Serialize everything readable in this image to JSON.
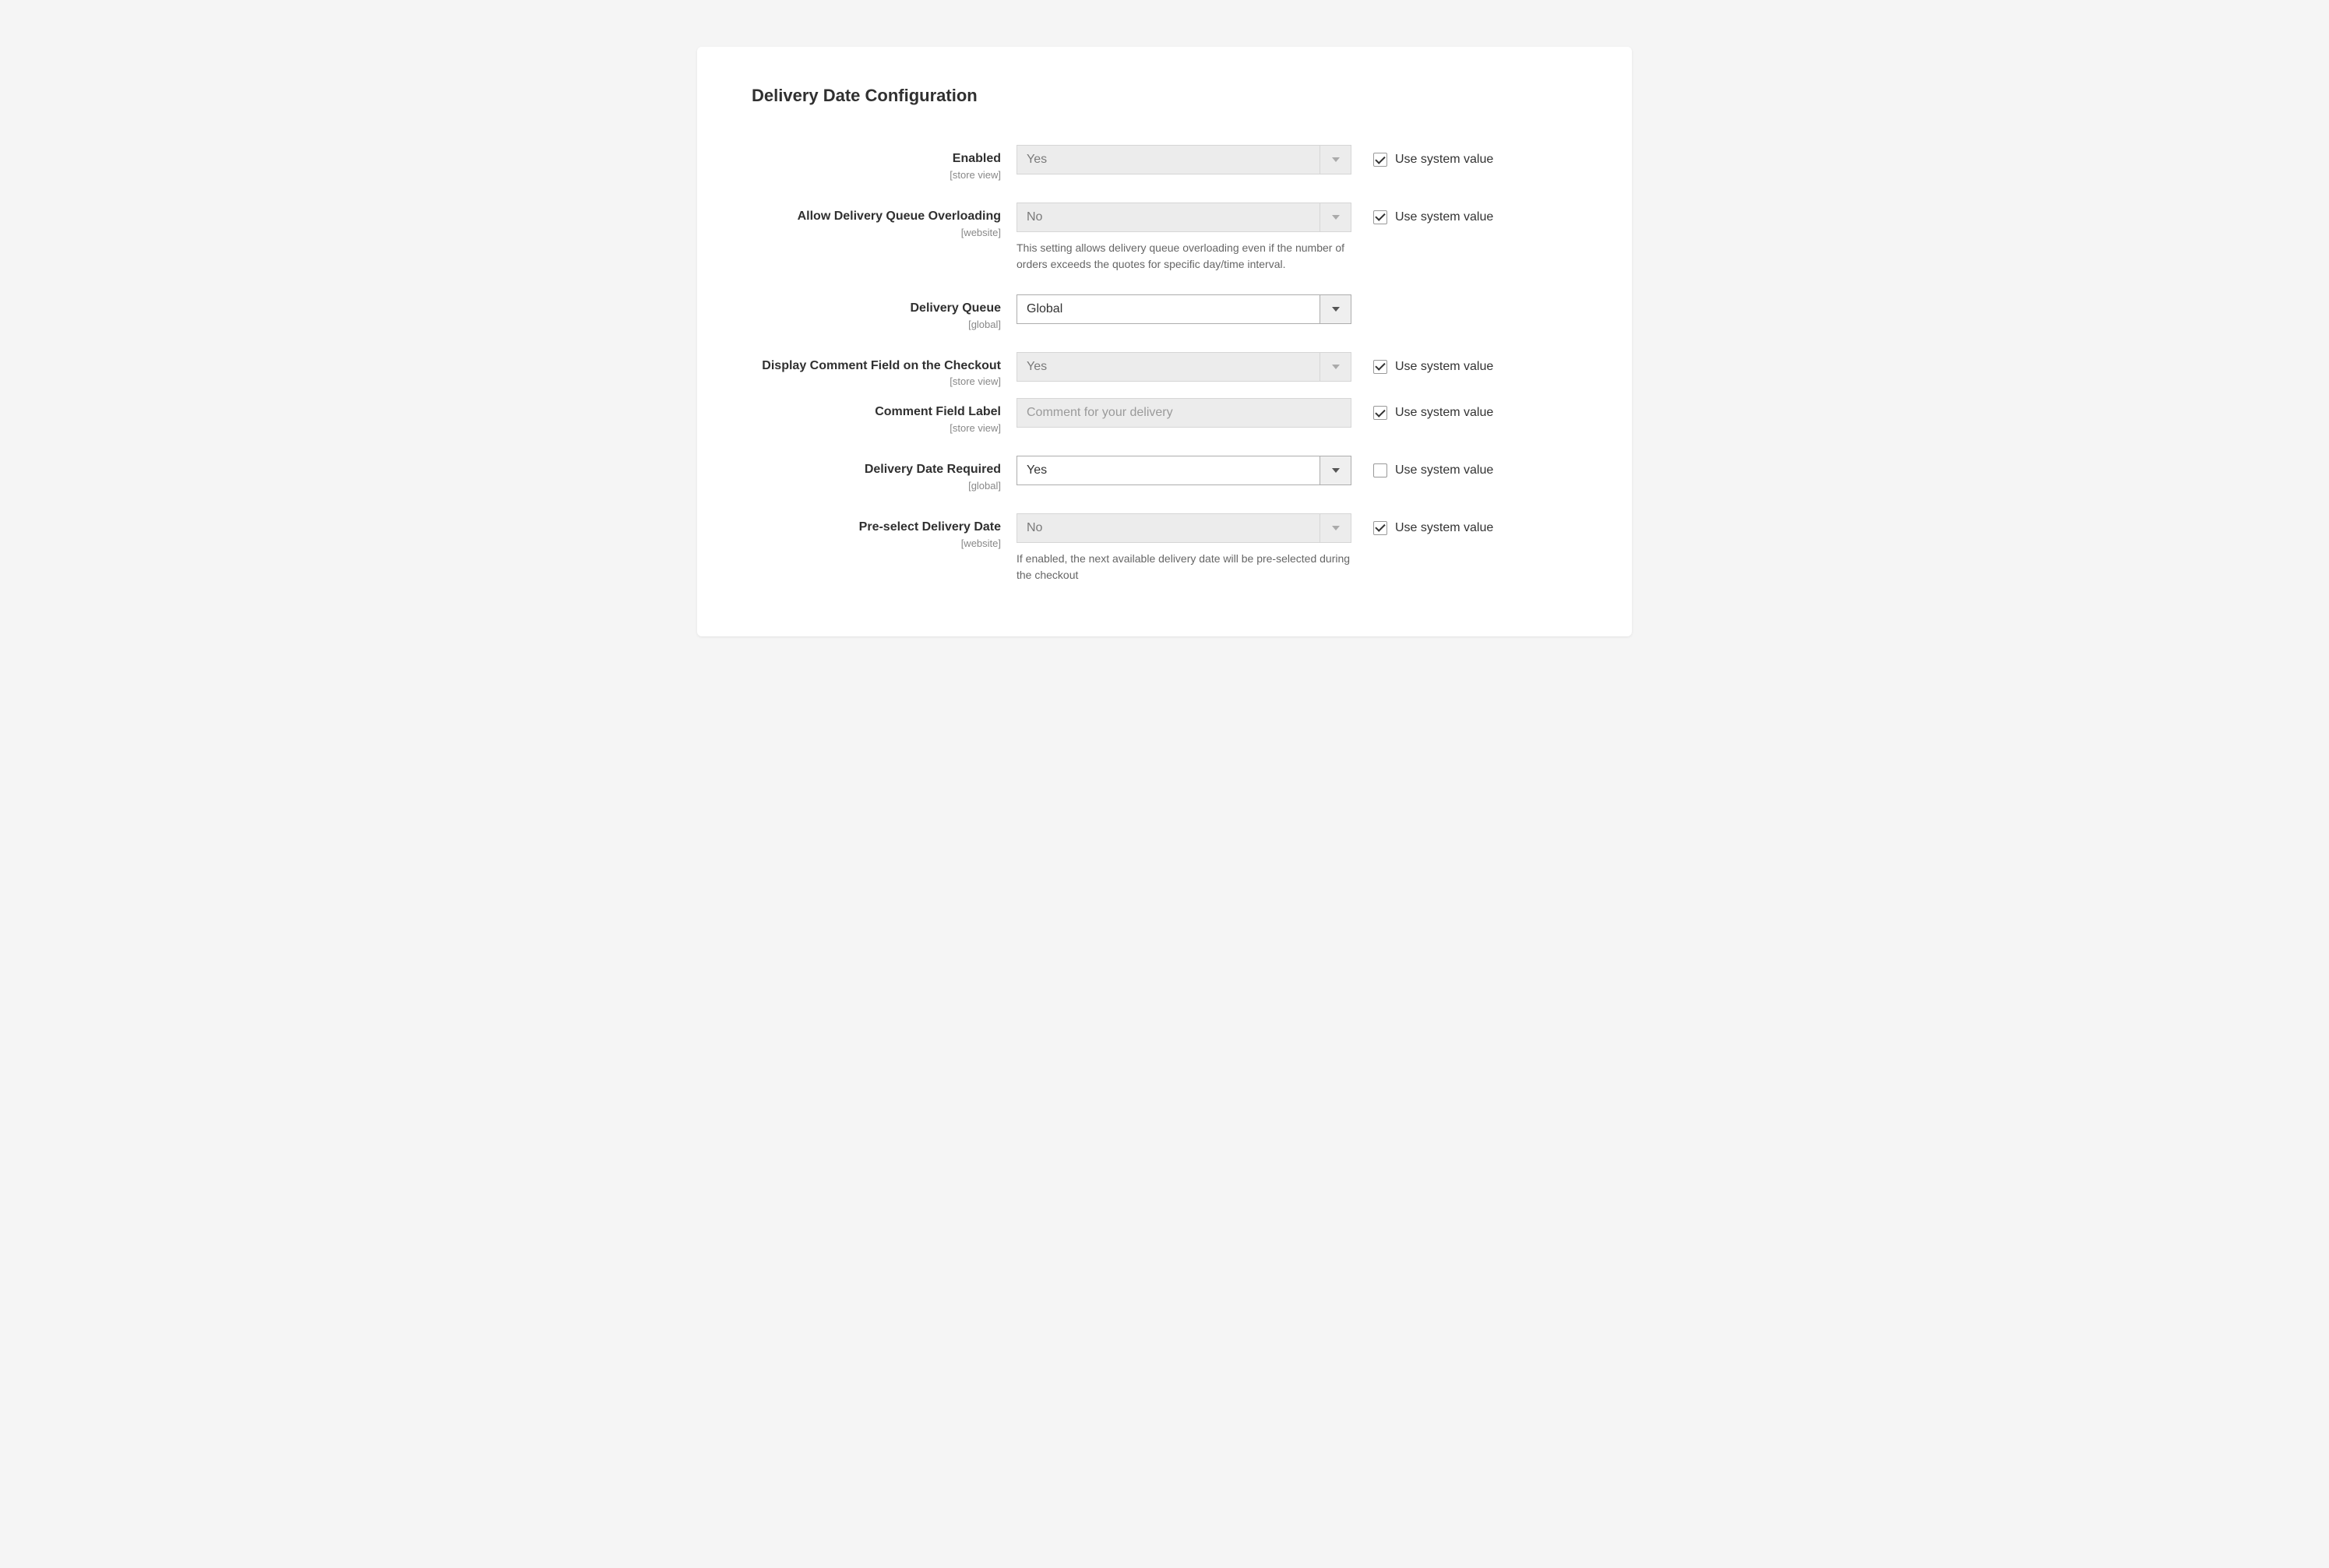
{
  "section_title": "Delivery Date Configuration",
  "use_system_value_label": "Use system value",
  "fields": {
    "enabled": {
      "label": "Enabled",
      "scope": "[store view]",
      "value": "Yes",
      "disabled": true,
      "use_system": true
    },
    "overloading": {
      "label": "Allow Delivery Queue Overloading",
      "scope": "[website]",
      "value": "No",
      "disabled": true,
      "use_system": true,
      "help": "This setting allows delivery queue overloading even if the number of orders exceeds the quotes for specific day/time interval."
    },
    "queue": {
      "label": "Delivery Queue",
      "scope": "[global]",
      "value": "Global",
      "disabled": false
    },
    "display_comment": {
      "label": "Display Comment Field on the Checkout",
      "scope": "[store view]",
      "value": "Yes",
      "disabled": true,
      "use_system": true
    },
    "comment_label": {
      "label": "Comment Field Label",
      "scope": "[store view]",
      "value": "Comment for your delivery",
      "disabled": true,
      "use_system": true
    },
    "required": {
      "label": "Delivery Date Required",
      "scope": "[global]",
      "value": "Yes",
      "disabled": false,
      "use_system": false
    },
    "preselect": {
      "label": "Pre-select Delivery Date",
      "scope": "[website]",
      "value": "No",
      "disabled": true,
      "use_system": true,
      "help": "If enabled, the next available delivery date will be pre-selected during the checkout"
    }
  }
}
